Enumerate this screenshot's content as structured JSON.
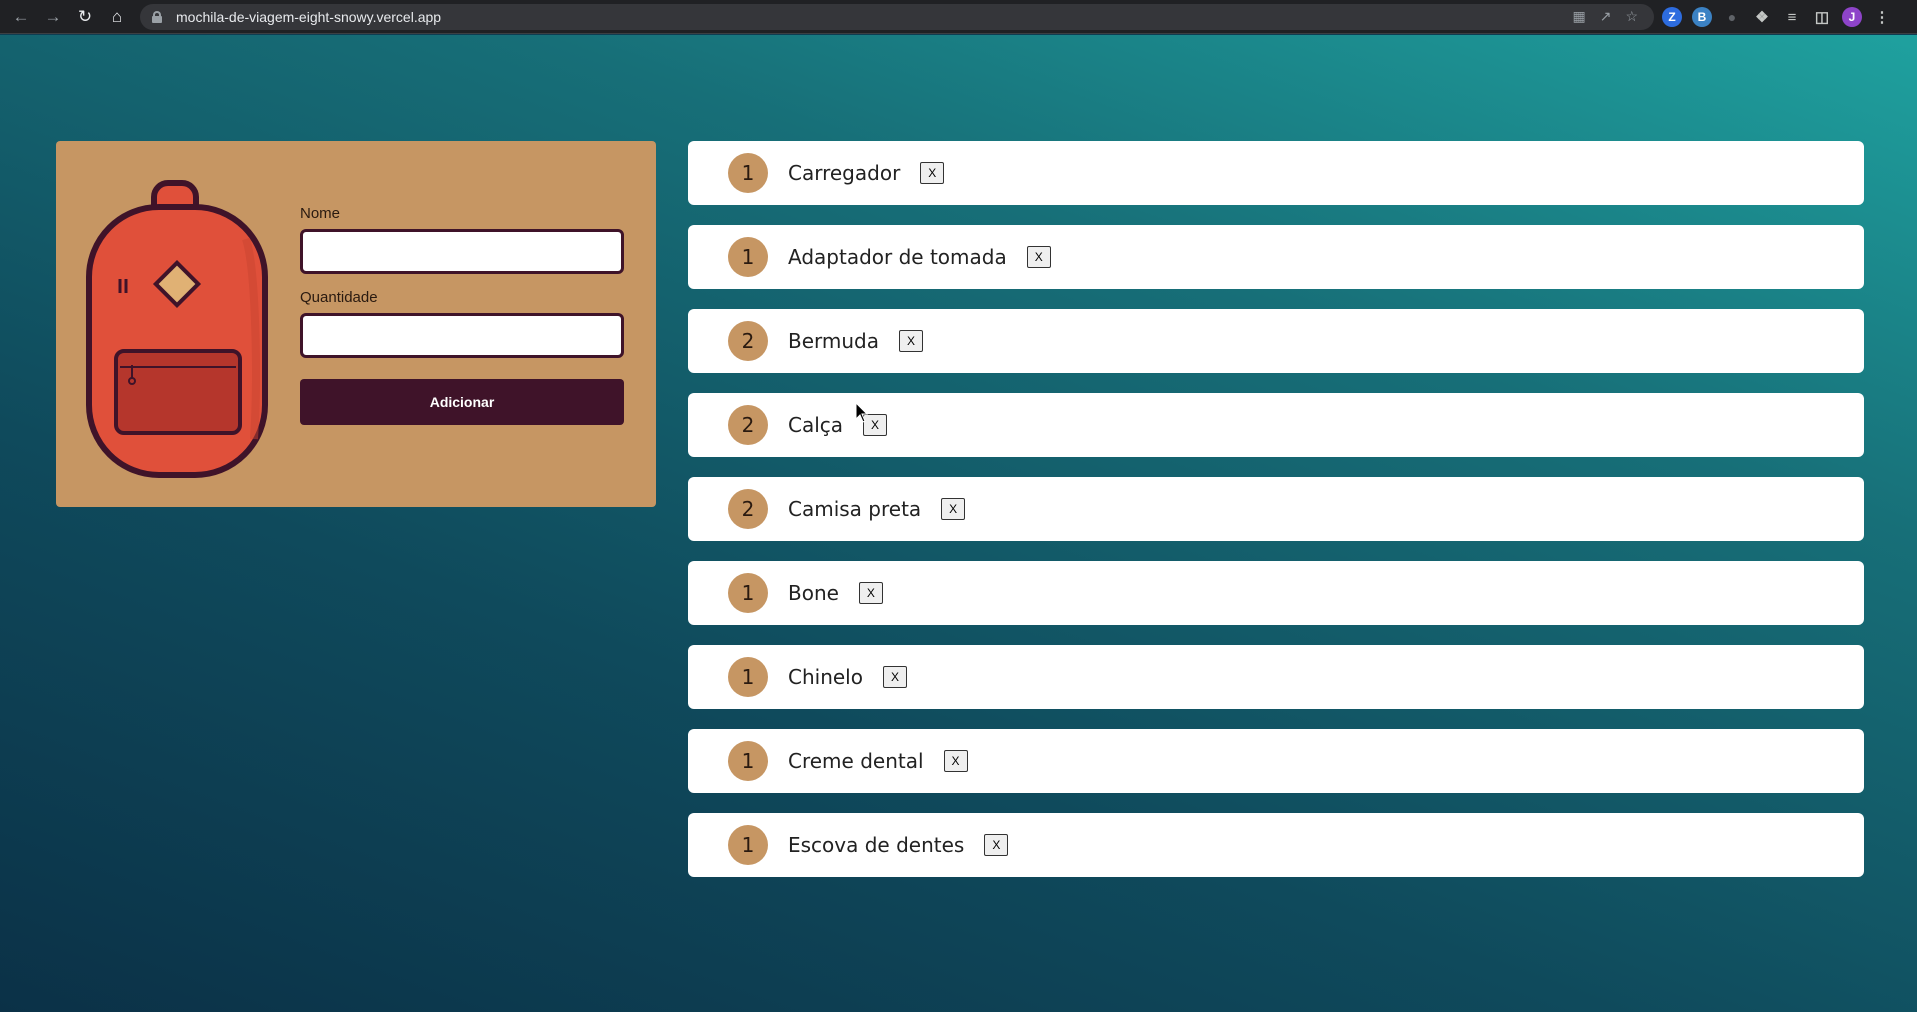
{
  "browser": {
    "url": "mochila-de-viagem-eight-snowy.vercel.app",
    "profile_initial": "J",
    "extensions": [
      "Z",
      "B"
    ]
  },
  "form": {
    "name_label": "Nome",
    "name_value": "",
    "quantity_label": "Quantidade",
    "quantity_value": "",
    "submit_label": "Adicionar"
  },
  "items": [
    {
      "quantity": "1",
      "name": "Carregador",
      "delete_label": "X"
    },
    {
      "quantity": "1",
      "name": "Adaptador de tomada",
      "delete_label": "X"
    },
    {
      "quantity": "2",
      "name": "Bermuda",
      "delete_label": "X"
    },
    {
      "quantity": "2",
      "name": "Calça",
      "delete_label": "X"
    },
    {
      "quantity": "2",
      "name": "Camisa preta",
      "delete_label": "X"
    },
    {
      "quantity": "1",
      "name": "Bone",
      "delete_label": "X"
    },
    {
      "quantity": "1",
      "name": "Chinelo",
      "delete_label": "X"
    },
    {
      "quantity": "1",
      "name": "Creme dental",
      "delete_label": "X"
    },
    {
      "quantity": "1",
      "name": "Escova de dentes",
      "delete_label": "X"
    }
  ],
  "colors": {
    "card": "#c69663",
    "button": "#3f1329",
    "backpack": "#e0503a",
    "backpack_outline": "#3f1329"
  }
}
